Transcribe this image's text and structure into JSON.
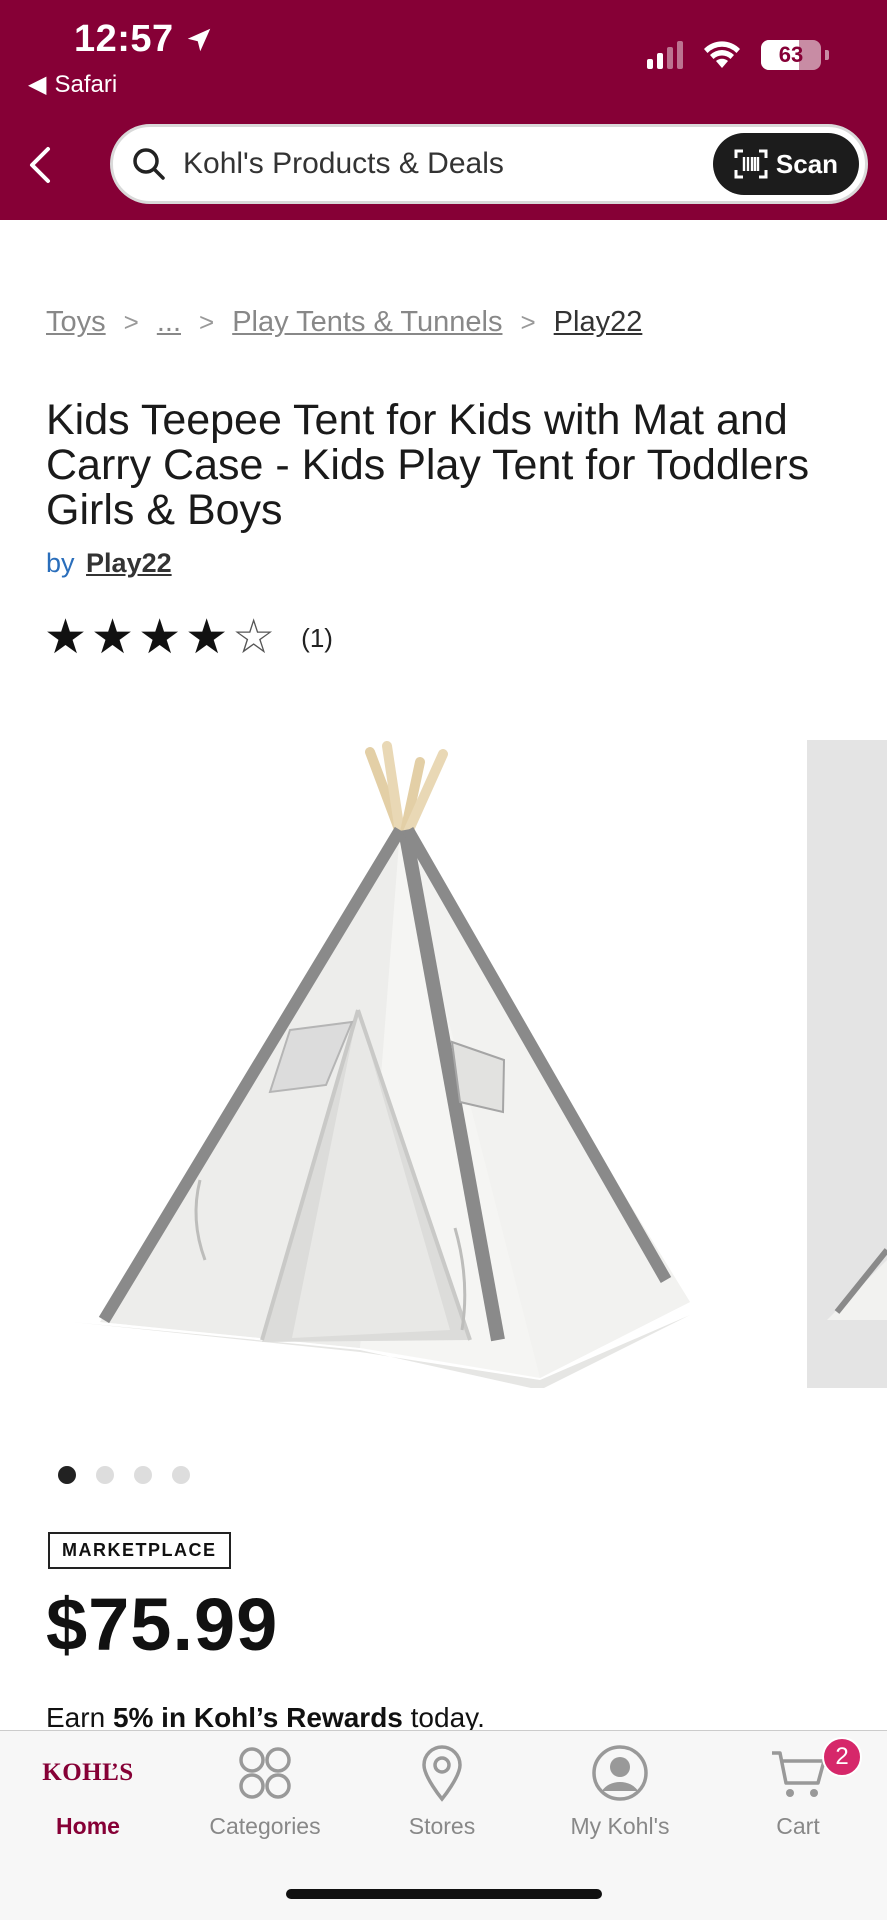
{
  "status": {
    "time": "12:57",
    "back_app": "Safari",
    "battery": "63"
  },
  "search": {
    "placeholder": "Kohl's Products & Deals",
    "scan_label": "Scan"
  },
  "breadcrumb": [
    "Toys",
    "...",
    "Play Tents & Tunnels",
    "Play22"
  ],
  "product": {
    "title": "Kids Teepee Tent for Kids with Mat and Carry Case - Kids Play Tent for Toddlers Girls & Boys",
    "by_label": "by",
    "brand": "Play22",
    "rating": 4,
    "rating_max": 5,
    "review_count": "(1)",
    "image_count": 4,
    "active_image": 0,
    "badge": "MARKETPLACE",
    "price": "$75.99",
    "rewards_prefix": "Earn",
    "rewards_bold": "5% in Kohl’s Rewards",
    "rewards_suffix": "today."
  },
  "tabbar": {
    "logo": "KOHĽS",
    "home": "Home",
    "categories": "Categories",
    "stores": "Stores",
    "my_kohls": "My Kohl's",
    "cart": "Cart",
    "cart_count": "2"
  },
  "colors": {
    "brand": "#860036",
    "link": "#2a6ebb",
    "badge": "#d6286a"
  }
}
